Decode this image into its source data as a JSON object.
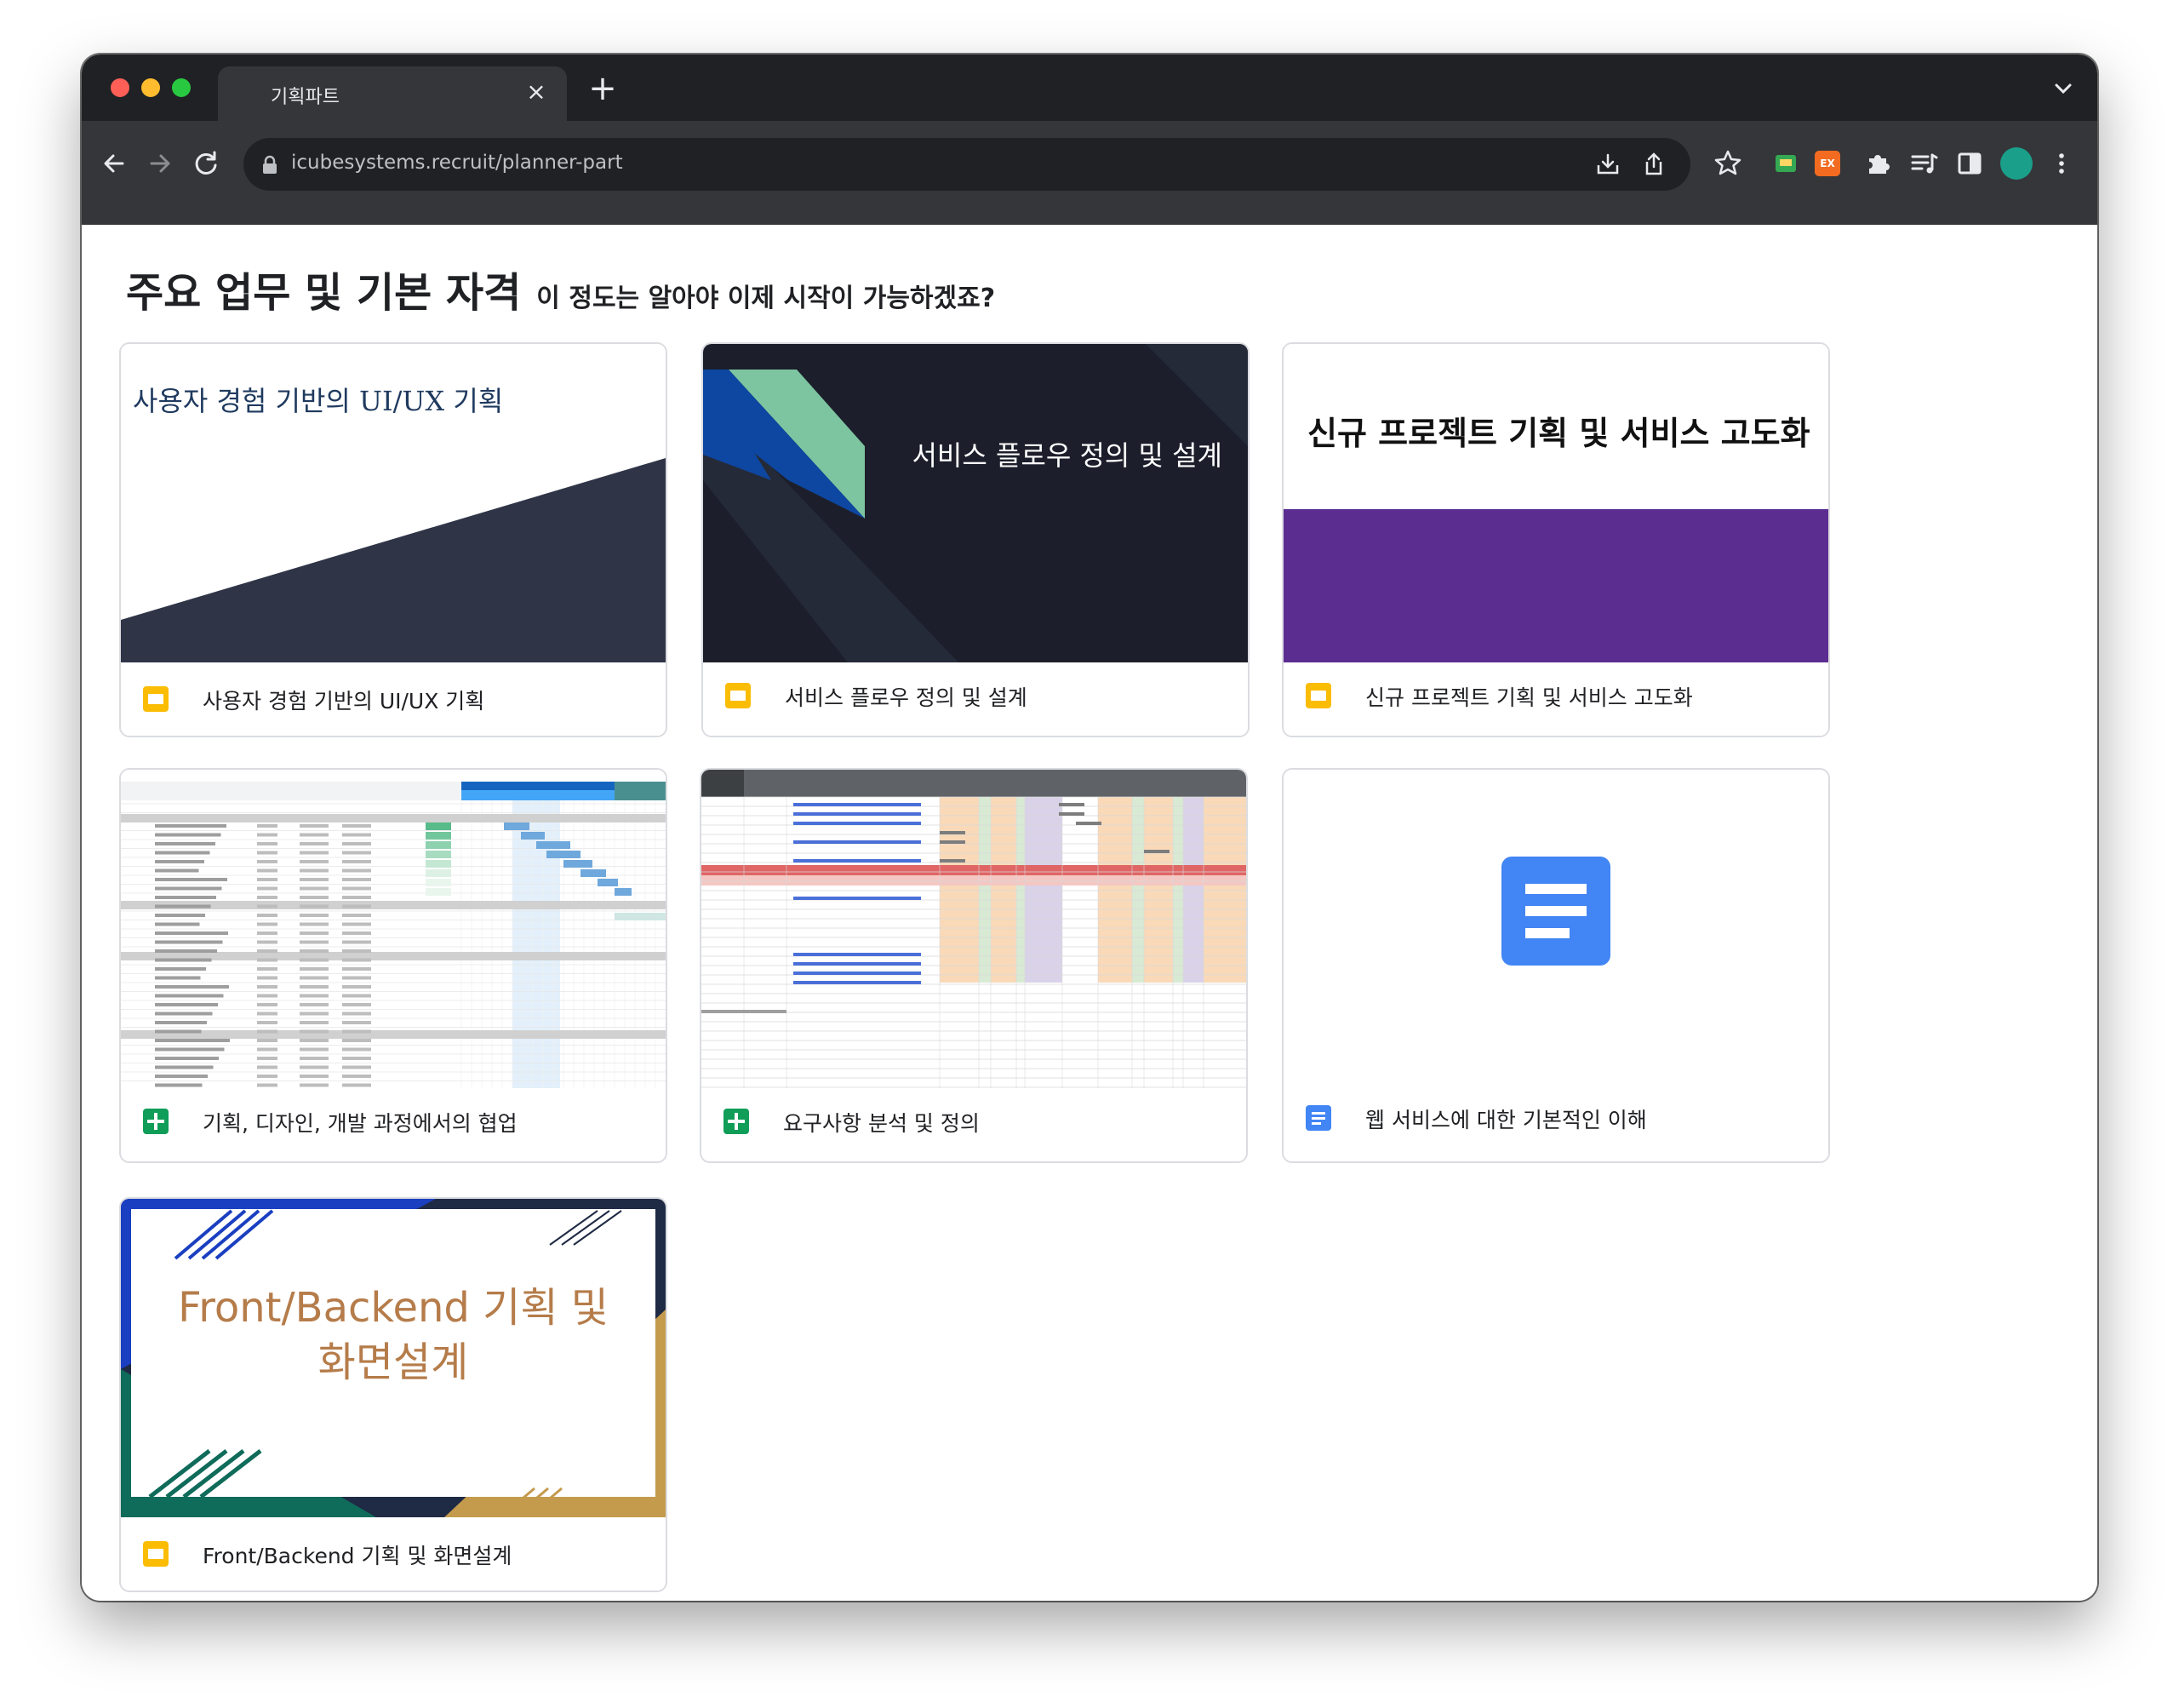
{
  "browser": {
    "tab_title": "기획파트",
    "tab_close": "×",
    "new_tab": "+",
    "url": "icubesystems.recruit/planner-part",
    "ext_label": "EX"
  },
  "page": {
    "title": "주요 업무 및 기본 자격",
    "subtitle": "이 정도는 알아야 이제 시작이 가능하겠죠?"
  },
  "cards": [
    {
      "thumb_title": "사용자 경험 기반의 UI/UX 기획",
      "label": "사용자 경험 기반의 UI/UX 기획",
      "type": "slides"
    },
    {
      "thumb_title": "서비스 플로우 정의 및 설계",
      "label": "서비스 플로우 정의 및 설계",
      "type": "slides"
    },
    {
      "thumb_title": "신규 프로젝트 기획 및 서비스 고도화",
      "label": "신규 프로젝트 기획 및 서비스  고도화",
      "type": "slides"
    },
    {
      "label": "기획, 디자인, 개발 과정에서의  협업",
      "type": "sheets"
    },
    {
      "label": "요구사항 분석 및 정의",
      "type": "sheets"
    },
    {
      "label": "웹 서비스에 대한 기본적인 이해",
      "type": "docs"
    },
    {
      "thumb_title_line1": "Front/Backend 기획 및",
      "thumb_title_line2": "화면설계",
      "label": "Front/Backend 기획 및  화면설계",
      "type": "slides"
    }
  ],
  "colors": {
    "tabbar": "#202124",
    "toolbar": "#35363a",
    "slides": "#fbbc04",
    "sheets": "#0f9d58",
    "docs": "#4285f4",
    "purple_band": "#5c2d91",
    "navy": "#2f3447",
    "dark_slide": "#1c1f2b",
    "tan": "#b57c4a"
  }
}
